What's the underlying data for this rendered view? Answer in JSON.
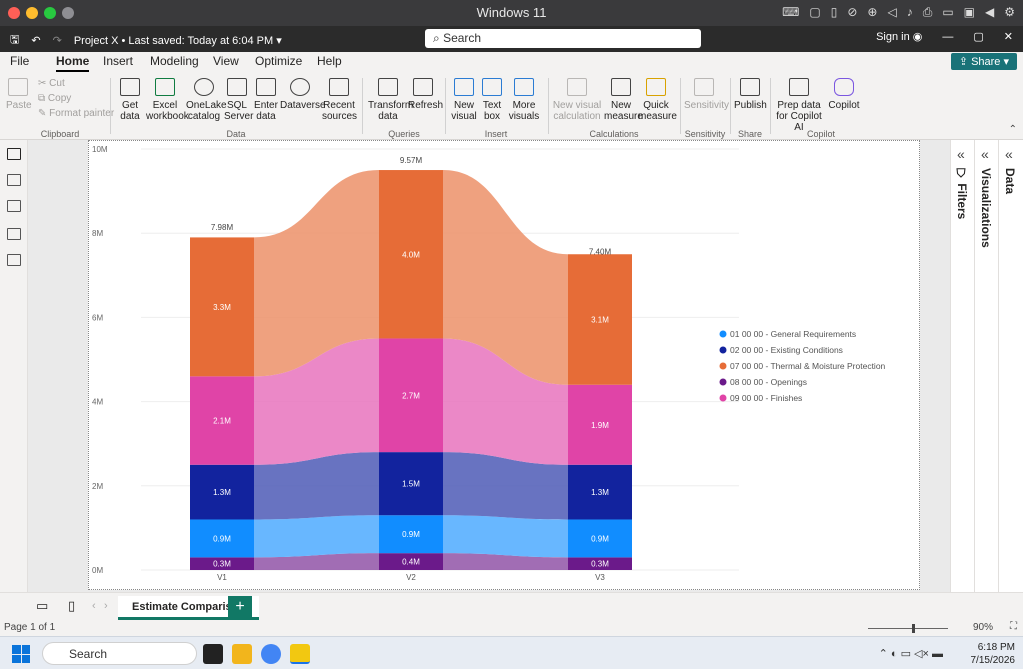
{
  "os": {
    "window_title": "Windows 11",
    "taskbar_search": "Search",
    "time": "6:18 PM",
    "date": "7/15/2026"
  },
  "titlebar": {
    "project": "Project X",
    "saved": "Last saved: Today at 6:04 PM",
    "search": "Search",
    "signin": "Sign in"
  },
  "tabs": [
    "File",
    "Home",
    "Insert",
    "Modeling",
    "View",
    "Optimize",
    "Help"
  ],
  "share_label": "Share",
  "ribbon": {
    "clipboard": {
      "paste": "Paste",
      "cut": "Cut",
      "copy": "Copy",
      "format_painter": "Format painter",
      "label": "Clipboard"
    },
    "data": {
      "get_data": "Get data",
      "excel": "Excel workbook",
      "onelake": "OneLake catalog",
      "sql": "SQL Server",
      "enter": "Enter data",
      "dataverse": "Dataverse",
      "recent": "Recent sources",
      "label": "Data"
    },
    "queries": {
      "transform": "Transform data",
      "refresh": "Refresh",
      "label": "Queries"
    },
    "insert": {
      "new_visual": "New visual",
      "text_box": "Text box",
      "more": "More visuals",
      "label": "Insert"
    },
    "calculations": {
      "new_visual_calc": "New visual calculation",
      "new_measure": "New measure",
      "quick_measure": "Quick measure",
      "label": "Calculations"
    },
    "sensitivity": {
      "btn": "Sensitivity",
      "label": "Sensitivity"
    },
    "share": {
      "publish": "Publish",
      "label": "Share"
    },
    "copilot": {
      "prep": "Prep data for Copilot AI",
      "copilot": "Copilot",
      "label": "Copilot"
    }
  },
  "panes": {
    "filters": "Filters",
    "visualizations": "Visualizations",
    "data": "Data"
  },
  "page_tab": "Estimate Comparison",
  "status": {
    "page": "Page 1 of 1",
    "zoom": "90%"
  },
  "chart_data": {
    "type": "bar",
    "stacked": true,
    "ribbon": true,
    "categories": [
      "V1",
      "V2",
      "V3"
    ],
    "y_ticks": [
      "0M",
      "2M",
      "4M",
      "6M",
      "8M",
      "10M"
    ],
    "ylim": [
      0,
      10
    ],
    "totals": [
      "7.98M",
      "9.57M",
      "7.40M"
    ],
    "total_values": [
      7.98,
      9.57,
      7.4
    ],
    "series": [
      {
        "name": "08 00 00 - Openings",
        "color": "#6b1a8a",
        "values": [
          0.3,
          0.4,
          0.3
        ],
        "labels": [
          "0.3M",
          "0.4M",
          "0.3M"
        ]
      },
      {
        "name": "01 00 00 - General Requirements",
        "color": "#118dff",
        "values": [
          0.9,
          0.9,
          0.9
        ],
        "labels": [
          "0.9M",
          "0.9M",
          "0.9M"
        ]
      },
      {
        "name": "02 00 00 - Existing Conditions",
        "color": "#12239e",
        "values": [
          1.3,
          1.5,
          1.3
        ],
        "labels": [
          "1.3M",
          "1.5M",
          "1.3M"
        ]
      },
      {
        "name": "09 00 00 - Finishes",
        "color": "#e044a7",
        "values": [
          2.1,
          2.7,
          1.9
        ],
        "labels": [
          "2.1M",
          "2.7M",
          "1.9M"
        ]
      },
      {
        "name": "07 00 00 - Thermal & Moisture Protection",
        "color": "#e66c37",
        "values": [
          3.3,
          4.0,
          3.1
        ],
        "labels": [
          "3.3M",
          "4.0M",
          "3.1M"
        ]
      }
    ],
    "legend": [
      {
        "name": "01 00 00 - General Requirements",
        "color": "#118dff"
      },
      {
        "name": "02 00 00 - Existing Conditions",
        "color": "#12239e"
      },
      {
        "name": "07 00 00 - Thermal & Moisture Protection",
        "color": "#e66c37"
      },
      {
        "name": "08 00 00 - Openings",
        "color": "#6b1a8a"
      },
      {
        "name": "09 00 00 - Finishes",
        "color": "#e044a7"
      }
    ],
    "legend_position": "right"
  }
}
